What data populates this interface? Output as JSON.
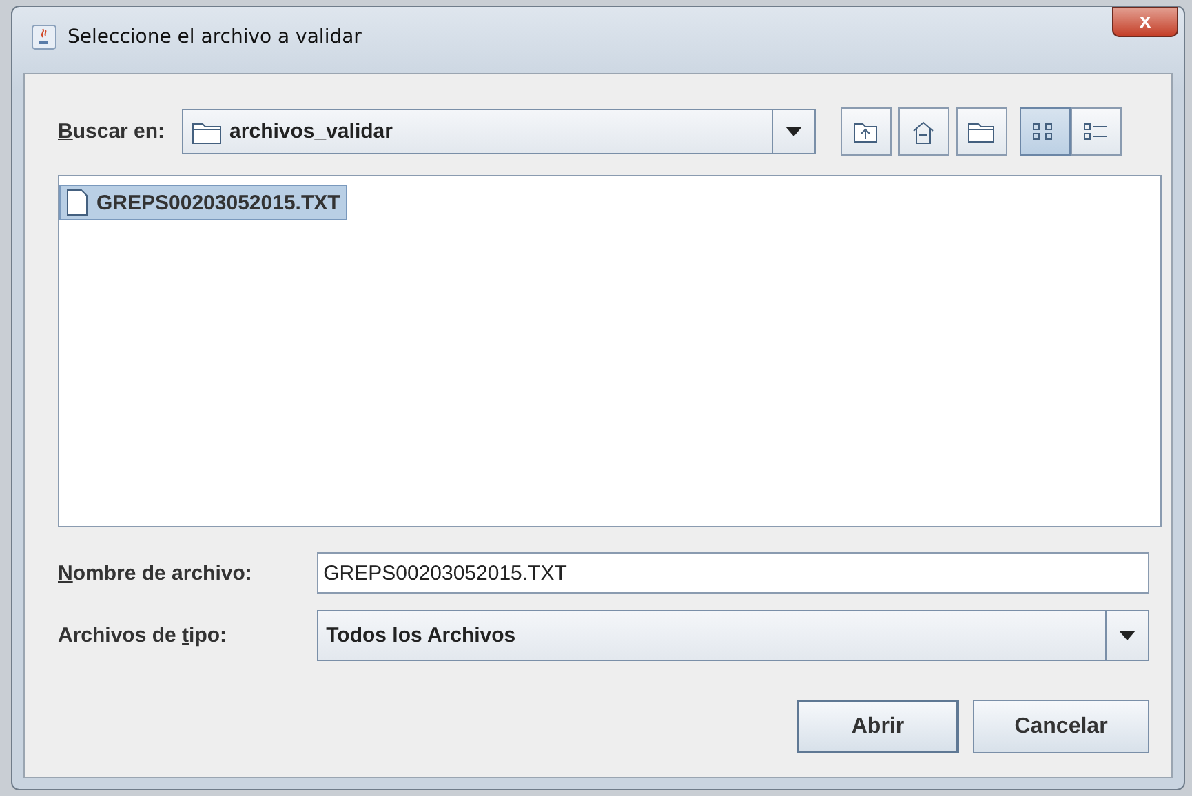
{
  "window": {
    "title": "Seleccione el archivo a validar",
    "close": "x"
  },
  "look_in": {
    "label": {
      "key": "B",
      "after": "uscar en:"
    },
    "value": "archivos_validar"
  },
  "toolbar": [
    {
      "kind": "up",
      "selected": false
    },
    {
      "kind": "home",
      "selected": false
    },
    {
      "kind": "new-folder",
      "selected": false
    },
    {
      "kind": "list",
      "selected": true
    },
    {
      "kind": "details",
      "selected": false
    }
  ],
  "files": [
    {
      "name": "GREPS00203052015.TXT",
      "selected": true
    }
  ],
  "file_name": {
    "label": {
      "key": "N",
      "after": "ombre de archivo:"
    },
    "value": "GREPS00203052015.TXT"
  },
  "file_type": {
    "label": {
      "before": "Archivos de ",
      "key": "t",
      "after": "ipo:"
    },
    "value": "Todos los Archivos"
  },
  "buttons": [
    "Abrir",
    "Cancelar"
  ]
}
